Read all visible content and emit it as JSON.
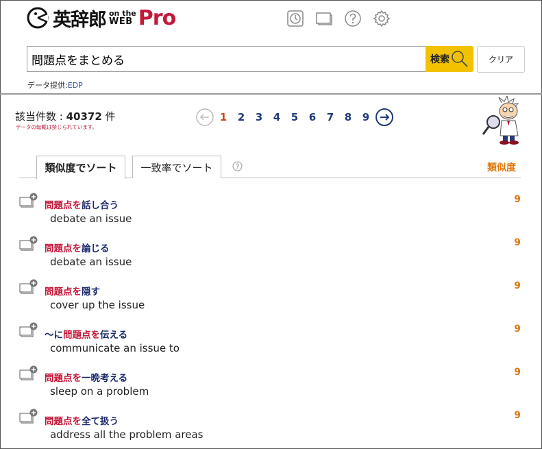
{
  "header": {
    "logo_main": "英辞郎",
    "logo_on_the": "on the",
    "logo_web": "WEB",
    "logo_pro": "Pro",
    "icons": [
      "history-icon",
      "wordbook-icon",
      "help-icon",
      "settings-icon"
    ]
  },
  "search": {
    "value": "問題点をまとめる",
    "button_label": "検索",
    "clear_label": "クリア",
    "provider_label": "データ提供:",
    "provider_name": "EDP"
  },
  "summary": {
    "count_label": "該当件数 : ",
    "count_value": "40372",
    "count_unit": " 件",
    "notice": "データの転載は禁じられています。"
  },
  "pagination": {
    "pages": [
      "1",
      "2",
      "3",
      "4",
      "5",
      "6",
      "7",
      "8",
      "9"
    ],
    "current": "1"
  },
  "tabs": {
    "active": "類似度でソート",
    "other": "一致率でソート",
    "sort_column": "類似度"
  },
  "results": [
    {
      "prefix": "",
      "highlight": "問題点を",
      "rest": "話し合う",
      "meaning": "debate an issue",
      "score": "9"
    },
    {
      "prefix": "",
      "highlight": "問題点を",
      "rest": "論じる",
      "meaning": "debate an issue",
      "score": "9"
    },
    {
      "prefix": "",
      "highlight": "問題点を",
      "rest": "隠す",
      "meaning": "cover up the issue",
      "score": "9"
    },
    {
      "prefix": "～に",
      "highlight": "問題点を",
      "rest": "伝える",
      "meaning": "communicate an issue to",
      "score": "9"
    },
    {
      "prefix": "",
      "highlight": "問題点を",
      "rest": "一晩考える",
      "meaning": "sleep on a problem",
      "score": "9"
    },
    {
      "prefix": "",
      "highlight": "問題点を",
      "rest": "全て扱う",
      "meaning": "address all the problem areas",
      "score": "9"
    }
  ],
  "colors": {
    "accent_yellow": "#f2c200",
    "highlight_red": "#c31a3a",
    "score_orange": "#e07a10",
    "link_blue": "#1f3a7a"
  }
}
